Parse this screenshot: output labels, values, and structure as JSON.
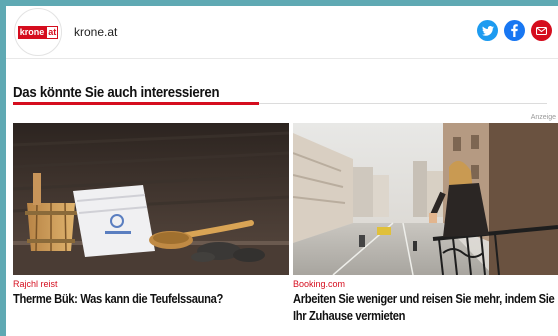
{
  "header": {
    "logo": {
      "brand": "krone",
      "suffix": "at"
    },
    "site_name": "krone.at",
    "social": [
      {
        "icon": "twitter-icon",
        "color": "#1d9bf0"
      },
      {
        "icon": "facebook-icon",
        "color": "#1877f2"
      },
      {
        "icon": "mail-icon",
        "color": "#d50d1e"
      }
    ]
  },
  "section": {
    "title": "Das könnte Sie auch interessieren",
    "ad_label": "Anzeige",
    "accent": "#d50d1e"
  },
  "cards": [
    {
      "source": "Rajchl reist",
      "headline": "Therme Bük: Was kann die Teufelssauna?"
    },
    {
      "source": "Booking.com",
      "headline": "Arbeiten Sie weniger und reisen Sie mehr, indem Sie Ihr Zuhause vermieten"
    }
  ]
}
